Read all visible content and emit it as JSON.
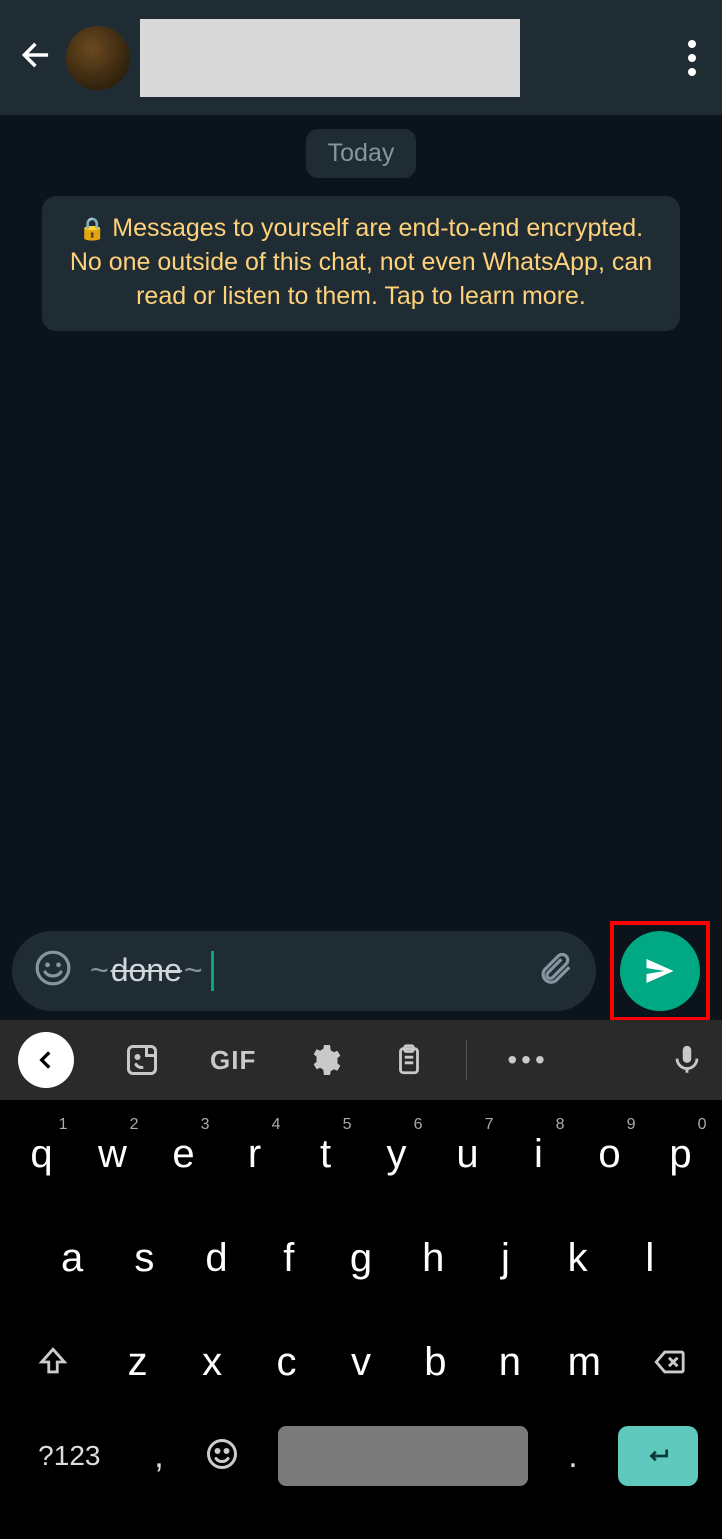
{
  "header": {
    "contact_name": ""
  },
  "chat": {
    "date_label": "Today",
    "encryption_notice": "Messages to yourself are end-to-end encrypted. No one outside of this chat, not even WhatsApp, can read or listen to them. Tap to learn more."
  },
  "composer": {
    "tilde_before": "~",
    "text": "done",
    "tilde_after": "~"
  },
  "kb_toolbar": {
    "gif_label": "GIF",
    "more_label": "•••"
  },
  "keyboard": {
    "row1": [
      {
        "k": "q",
        "s": "1"
      },
      {
        "k": "w",
        "s": "2"
      },
      {
        "k": "e",
        "s": "3"
      },
      {
        "k": "r",
        "s": "4"
      },
      {
        "k": "t",
        "s": "5"
      },
      {
        "k": "y",
        "s": "6"
      },
      {
        "k": "u",
        "s": "7"
      },
      {
        "k": "i",
        "s": "8"
      },
      {
        "k": "o",
        "s": "9"
      },
      {
        "k": "p",
        "s": "0"
      }
    ],
    "row2": [
      "a",
      "s",
      "d",
      "f",
      "g",
      "h",
      "j",
      "k",
      "l"
    ],
    "row3": [
      "z",
      "x",
      "c",
      "v",
      "b",
      "n",
      "m"
    ],
    "sym_label": "?123",
    "comma": ",",
    "dot": "."
  }
}
